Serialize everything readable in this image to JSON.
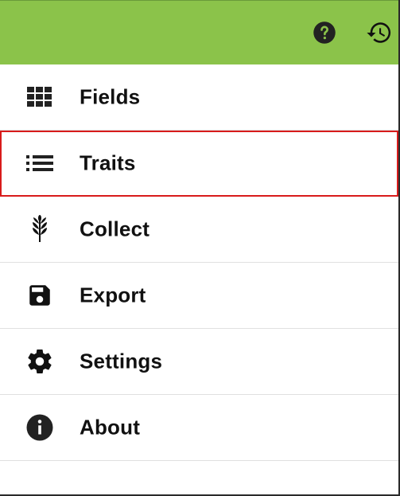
{
  "colors": {
    "toolbar_bg": "#8bc34a",
    "selected_border": "#d81b1b",
    "icon": "#222222"
  },
  "toolbar": {
    "help_icon": "help-circle-icon",
    "history_icon": "history-icon"
  },
  "menu": {
    "items": [
      {
        "label": "Fields",
        "icon": "grid-icon"
      },
      {
        "label": "Traits",
        "icon": "list-icon",
        "selected": true
      },
      {
        "label": "Collect",
        "icon": "wheat-icon"
      },
      {
        "label": "Export",
        "icon": "floppy-disk-icon"
      },
      {
        "label": "Settings",
        "icon": "gear-icon"
      },
      {
        "label": "About",
        "icon": "info-icon"
      }
    ]
  }
}
